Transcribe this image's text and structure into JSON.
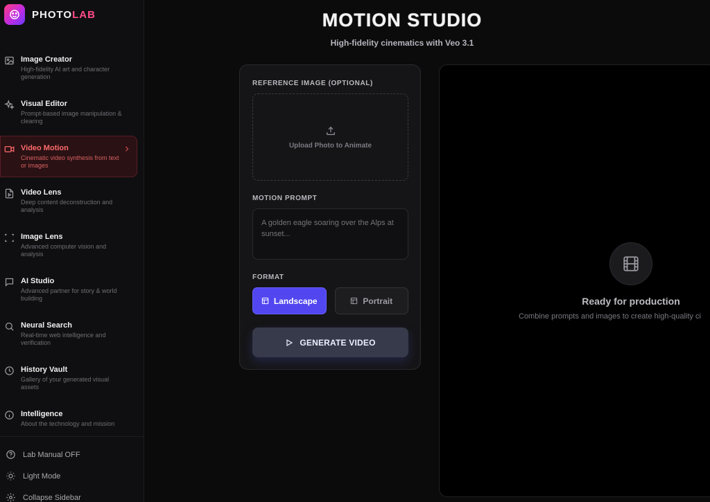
{
  "brand": {
    "name_a": "PHOTO",
    "name_b": "LAB"
  },
  "sidebar": {
    "items": [
      {
        "title": "Image Creator",
        "desc": "High-fidelity AI art and character generation",
        "icon": "image-icon"
      },
      {
        "title": "Visual Editor",
        "desc": "Prompt-based image manipulation & clearing",
        "icon": "sparkles-icon"
      },
      {
        "title": "Video Motion",
        "desc": "Cinematic video synthesis from text or images",
        "icon": "video-camera-icon",
        "active": true
      },
      {
        "title": "Video Lens",
        "desc": "Deep content deconstruction and analysis",
        "icon": "video-file-icon"
      },
      {
        "title": "Image Lens",
        "desc": "Advanced computer vision and analysis",
        "icon": "scan-icon"
      },
      {
        "title": "AI Studio",
        "desc": "Advanced partner for story & world building",
        "icon": "chat-bubble-icon"
      },
      {
        "title": "Neural Search",
        "desc": "Real-time web intelligence and verification",
        "icon": "search-icon"
      },
      {
        "title": "History Vault",
        "desc": "Gallery of your generated visual assets",
        "icon": "clock-icon"
      },
      {
        "title": "Intelligence",
        "desc": "About the technology and mission",
        "icon": "info-icon"
      }
    ],
    "footer": {
      "lab_manual": "Lab Manual OFF",
      "light_mode": "Light Mode",
      "collapse": "Collapse Sidebar"
    }
  },
  "header": {
    "title": "MOTION STUDIO",
    "subtitle": "High-fidelity cinematics with Veo 3.1"
  },
  "panel": {
    "reference_label": "REFERENCE IMAGE (OPTIONAL)",
    "upload_text": "Upload Photo to Animate",
    "prompt_label": "MOTION PROMPT",
    "prompt_placeholder": "A golden eagle soaring over the Alps at sunset...",
    "format_label": "FORMAT",
    "format_options": [
      "Landscape",
      "Portrait"
    ],
    "format_selected": "Landscape",
    "generate_label": "GENERATE VIDEO"
  },
  "preview": {
    "title": "Ready for production",
    "subtitle": "Combine prompts and images to create high-quality ci"
  },
  "colors": {
    "accent": "#5146f0",
    "active_nav": "#ff6b6b",
    "brand_pink": "#ff4b8b"
  }
}
